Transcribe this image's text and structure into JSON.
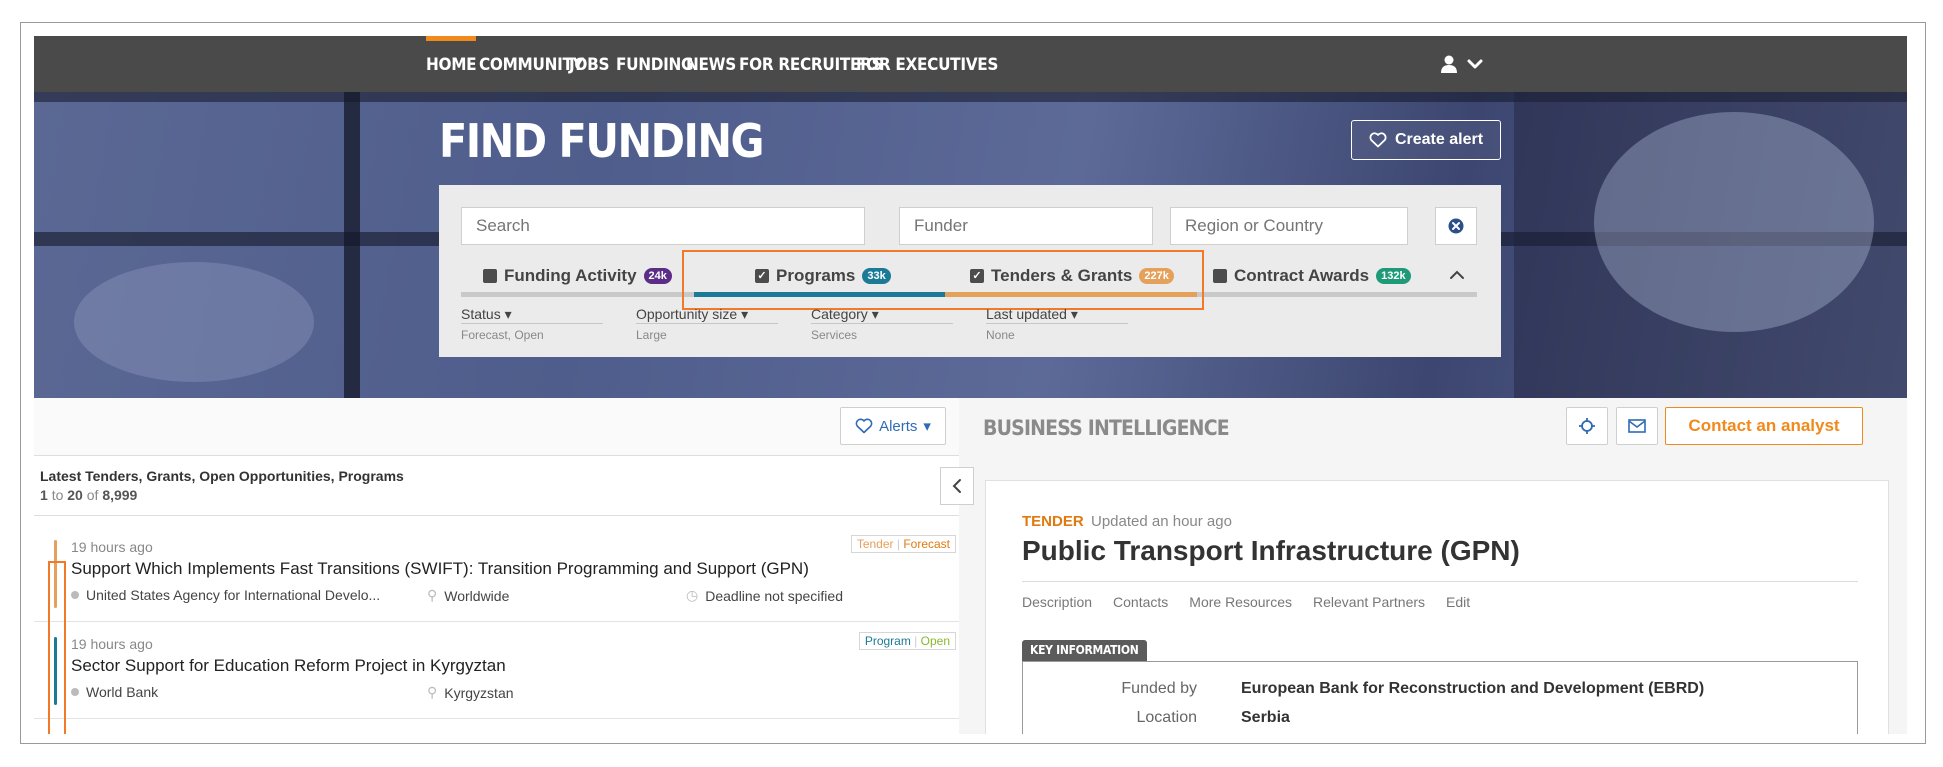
{
  "nav": {
    "items": [
      "HOME",
      "COMMUNITY",
      "JOBS",
      "FUNDING",
      "NEWS",
      "FOR RECRUITERS",
      "FOR EXECUTIVES"
    ],
    "active_index": 0
  },
  "hero": {
    "title": "FIND FUNDING",
    "create_alert_label": "Create alert"
  },
  "search": {
    "search_placeholder": "Search",
    "funder_placeholder": "Funder",
    "region_placeholder": "Region or Country"
  },
  "tabs": [
    {
      "label": "Funding Activity",
      "count": "24k",
      "checked": false,
      "color": "#5b2d86"
    },
    {
      "label": "Programs",
      "count": "33k",
      "checked": true,
      "color": "#1b7a96"
    },
    {
      "label": "Tenders & Grants",
      "count": "227k",
      "checked": true,
      "color": "#e5a05a"
    },
    {
      "label": "Contract Awards",
      "count": "132k",
      "checked": false,
      "color": "#1f9a78"
    }
  ],
  "filters": [
    {
      "label": "Status",
      "value": "Forecast, Open"
    },
    {
      "label": "Opportunity size",
      "value": "Large"
    },
    {
      "label": "Category",
      "value": "Services"
    },
    {
      "label": "Last updated",
      "value": "None"
    }
  ],
  "list": {
    "alerts_label": "Alerts",
    "title": "Latest Tenders, Grants, Open Opportunities, Programs",
    "range_start": "1",
    "range_to": "to",
    "range_end": "20",
    "range_of": "of",
    "total": "8,999",
    "results": [
      {
        "ago": "19 hours ago",
        "title": "Support Which Implements Fast Transitions (SWIFT): Transition Programming and Support (GPN)",
        "funder": "United States Agency for International Develo...",
        "location": "Worldwide",
        "deadline": "Deadline not specified",
        "tag_type": "Tender",
        "tag_status": "Forecast",
        "tag_color": "#e5a05a",
        "stripe_color": "#e5a05a"
      },
      {
        "ago": "19 hours ago",
        "title": "Sector Support for Education Reform Project in Kyrgyztan",
        "funder": "World Bank",
        "location": "Kyrgyzstan",
        "deadline": "",
        "tag_type": "Program",
        "tag_status": "Open",
        "tag_color": "#1b7a96",
        "stripe_color": "#1b7a96"
      }
    ]
  },
  "bi": {
    "title": "BUSINESS INTELLIGENCE",
    "contact_label": "Contact an analyst"
  },
  "detail": {
    "kind": "TENDER",
    "updated": "Updated an hour ago",
    "title": "Public Transport Infrastructure (GPN)",
    "tabs": [
      "Description",
      "Contacts",
      "More Resources",
      "Relevant Partners",
      "Edit"
    ],
    "key_info_label": "KEY INFORMATION",
    "rows": [
      {
        "key": "Funded by",
        "value": "European Bank for Reconstruction and Development (EBRD)"
      },
      {
        "key": "Location",
        "value": "Serbia"
      }
    ]
  },
  "colors": {
    "accent_orange": "#f18a1c",
    "nav_bg": "#4a4a4a",
    "link_blue": "#2f6cb5"
  }
}
